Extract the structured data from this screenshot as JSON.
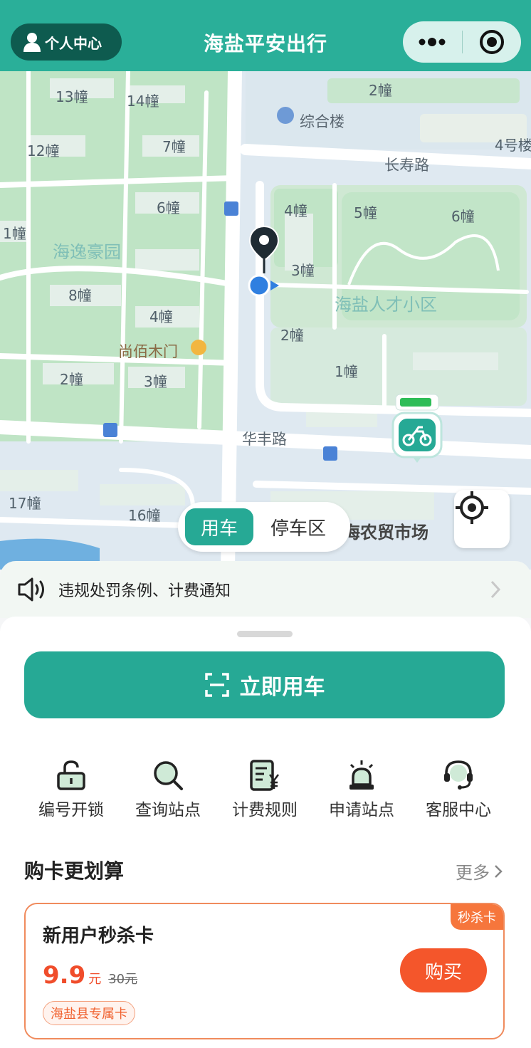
{
  "header": {
    "profile_label": "个人中心",
    "title": "海盐平安出行",
    "menu_icon": "more-dots-icon",
    "close_icon": "target-circle-icon"
  },
  "map": {
    "labels": {
      "b13": "13幢",
      "b14": "14幢",
      "b12": "12幢",
      "b7": "7幢",
      "b2_top": "2幢",
      "zonghelou": "综合楼",
      "b4_right": "4号楼",
      "changshoulu": "长寿路",
      "b6_left": "6幢",
      "b1_left": "1幢",
      "haiyihaoyuan": "海逸豪园",
      "b4_mid": "4幢",
      "b5": "5幢",
      "b6_right": "6幢",
      "b3_mid": "3幢",
      "b8": "8幢",
      "b4_low": "4幢",
      "rencai": "海盐人才小区",
      "b2_mid": "2幢",
      "shangbaimumen": "尚佰木门",
      "b1_mid": "1幢",
      "b2_left": "2幢",
      "b3_left": "3幢",
      "huafenglu": "华丰路",
      "b17": "17幢",
      "b16": "16幢",
      "market": "海农贸市场"
    },
    "mode_active": "用车",
    "mode_inactive": "停车区",
    "locate_icon": "locate-crosshair-icon"
  },
  "notice": {
    "text": "违规处罚条例、计费通知",
    "icon": "speaker-icon"
  },
  "panel": {
    "ride_button": "立即用车",
    "ride_icon": "scan-icon",
    "quick_actions": [
      {
        "label": "编号开锁",
        "icon": "unlock-icon"
      },
      {
        "label": "查询站点",
        "icon": "search-icon"
      },
      {
        "label": "计费规则",
        "icon": "billing-icon"
      },
      {
        "label": "申请站点",
        "icon": "alarm-light-icon"
      },
      {
        "label": "客服中心",
        "icon": "headset-icon"
      }
    ],
    "section_title": "购卡更划算",
    "more_label": "更多"
  },
  "card": {
    "tag": "秒杀卡",
    "title": "新用户秒杀卡",
    "price": "9.9",
    "price_unit": "元",
    "original_price": "30元",
    "region_tag": "海盐县专属卡",
    "buy_label": "购买"
  },
  "colors": {
    "primary": "#26a995",
    "header": "#2aaf99",
    "accent_orange": "#f4562b"
  }
}
